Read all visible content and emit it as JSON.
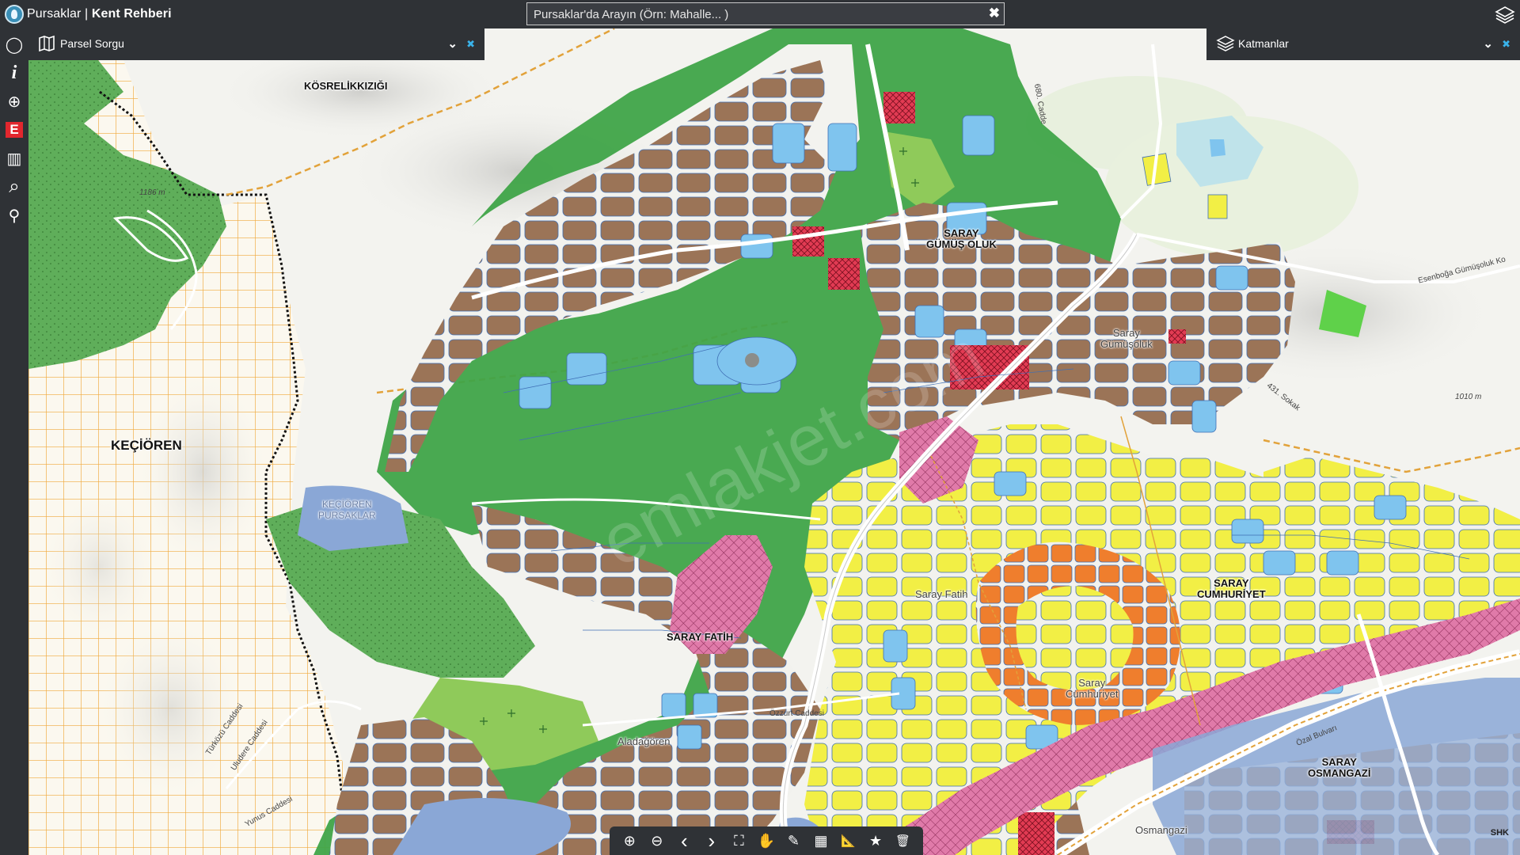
{
  "header": {
    "app_name": "Pursaklar",
    "separator": " | ",
    "app_subtitle": "Kent Rehberi",
    "search": {
      "placeholder": "Pursaklar'da Arayın (Örn: Mahalle... )",
      "value": "",
      "clear_symbol": "✖"
    },
    "layers_icon": "layers-icon"
  },
  "left_panel": {
    "title": "Parsel Sorgu",
    "icon": "map-book-icon",
    "collapse_symbol": "⌄",
    "close_symbol": "✖"
  },
  "right_panel": {
    "title": "Katmanlar",
    "icon": "layers-icon",
    "collapse_symbol": "⌄",
    "close_symbol": "✖"
  },
  "sidebar_tools": [
    {
      "name": "select-tool",
      "icon": "circle-icon",
      "glyph": "◯"
    },
    {
      "name": "info-tool",
      "icon": "info-icon",
      "glyph": "i"
    },
    {
      "name": "compass-tool",
      "icon": "compass-icon",
      "glyph": "⊕"
    },
    {
      "name": "e-plan-tool",
      "icon": "e-icon",
      "glyph": "E"
    },
    {
      "name": "map-book-tool",
      "icon": "book-icon",
      "glyph": "▥"
    },
    {
      "name": "search-map-tool",
      "icon": "magnifier-icon",
      "glyph": "⌕"
    },
    {
      "name": "user-location-tool",
      "icon": "person-icon",
      "glyph": "⚲"
    }
  ],
  "toolbar": [
    {
      "name": "zoom-in",
      "icon": "zoom-in-icon",
      "glyph": "⊕"
    },
    {
      "name": "zoom-out",
      "icon": "zoom-out-icon",
      "glyph": "⊖"
    },
    {
      "name": "previous-extent",
      "icon": "chevron-left-icon",
      "glyph": "‹"
    },
    {
      "name": "next-extent",
      "icon": "chevron-right-icon",
      "glyph": "›"
    },
    {
      "name": "full-extent",
      "icon": "fullscreen-icon",
      "glyph": "⛶"
    },
    {
      "name": "pan",
      "icon": "hand-icon",
      "glyph": "✋"
    },
    {
      "name": "draw",
      "icon": "pencil-icon",
      "glyph": "✎"
    },
    {
      "name": "grid",
      "icon": "grid-icon",
      "glyph": "▦"
    },
    {
      "name": "measure",
      "icon": "ruler-icon",
      "glyph": "📐"
    },
    {
      "name": "favorite",
      "icon": "star-icon",
      "glyph": "★"
    },
    {
      "name": "clear",
      "icon": "trash-icon",
      "glyph": "🗑"
    }
  ],
  "map_labels": {
    "kosrelik": "KÖSRELİKKIZIĞI",
    "kecioren": "KEÇİÖREN",
    "saray_gumus_oluk_1": "SARAY",
    "saray_gumus_oluk_2": "GÜMÜŞ OLUK",
    "saray_gumuseluk_1": "Saray",
    "saray_gumuseluk_2": "Gümüşoluk",
    "saray_fatih": "SARAY FATİH",
    "saray_fatih_soft": "Saray Fatih",
    "saray_cumhuriyet_1": "SARAY",
    "saray_cumhuriyet_2": "CUMHURİYET",
    "saray_cumhuriyet_soft_1": "Saray",
    "saray_cumhuriyet_soft_2": "Cumhuriyet",
    "saray_osmangazi_1": "SARAY",
    "saray_osmangazi_2": "OSMANGAZİ",
    "osmangazi_soft": "Osmangazi",
    "aladagoren": "Aladağören",
    "kecioren_pursaklar_1": "KEÇİÖREN",
    "kecioren_pursaklar_2": "PURSAKLAR"
  },
  "street_labels": {
    "cadde_680": "680. Cadde",
    "sokak_431": "431. Sokak",
    "elev_1010": "1010 m",
    "elev_1186": "1186 m",
    "esenboga": "Esenboğa Gümüşoluk Ko",
    "ozal_bulvari": "Özal Bulvarı",
    "ozzirt": "Özzurt Caddesi",
    "yunus": "Yunus Caddesi",
    "turkozu": "Türközü Caddesi",
    "uludere": "Uludere Caddesi"
  },
  "attribution": "SHK",
  "colors": {
    "chrome": "#2f3236",
    "residential_brown": "#9b7457",
    "residential_yellow": "#f2ef45",
    "commercial_orange": "#ef7e2d",
    "public_blue": "#7fc4ee",
    "green_park": "#3fa448",
    "forest_green": "#5fae5a",
    "industrial_pink": "#e07aa9",
    "hatched_red": "#e23b53",
    "water_blue": "#8aa7d6",
    "grid_orange": "#f0a93a",
    "district_border": "#111111"
  }
}
